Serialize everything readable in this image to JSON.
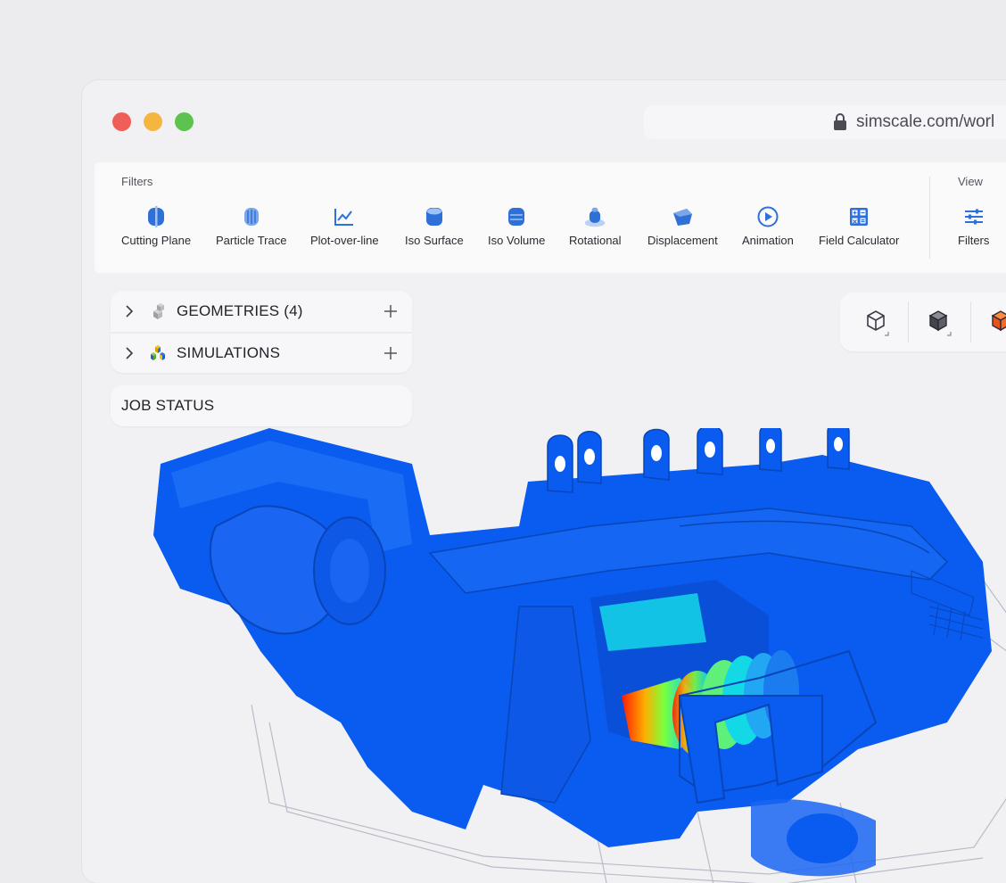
{
  "browser": {
    "url": "simscale.com/worl"
  },
  "toolbar": {
    "filters_label": "Filters",
    "view_label": "View",
    "tools": [
      {
        "label": "Cutting Plane",
        "icon": "cutting-plane-icon"
      },
      {
        "label": "Particle Trace",
        "icon": "particle-trace-icon"
      },
      {
        "label": "Plot-over-line",
        "icon": "plot-over-line-icon"
      },
      {
        "label": "Iso Surface",
        "icon": "iso-surface-icon"
      },
      {
        "label": "Iso Volume",
        "icon": "iso-volume-icon"
      },
      {
        "label": "Rotational",
        "icon": "rotational-icon"
      },
      {
        "label": "Displacement",
        "icon": "displacement-icon"
      },
      {
        "label": "Animation",
        "icon": "animation-icon"
      },
      {
        "label": "Field Calculator",
        "icon": "field-calculator-icon"
      }
    ],
    "view_tools": [
      {
        "label": "Filters",
        "icon": "sliders-icon"
      }
    ]
  },
  "tree": {
    "geometries_label": "GEOMETRIES (4)",
    "simulations_label": "SIMULATIONS"
  },
  "job_status": {
    "label": "JOB STATUS"
  },
  "view_controls": [
    {
      "icon": "wireframe-cube-icon"
    },
    {
      "icon": "solid-cube-icon"
    },
    {
      "icon": "orange-cube-icon"
    }
  ],
  "colors": {
    "accent": "#1f6fe5",
    "model_blue": "#0a5bf0",
    "close": "#ed5f57",
    "minimize": "#f4b63f",
    "maximize": "#5dc24f"
  }
}
